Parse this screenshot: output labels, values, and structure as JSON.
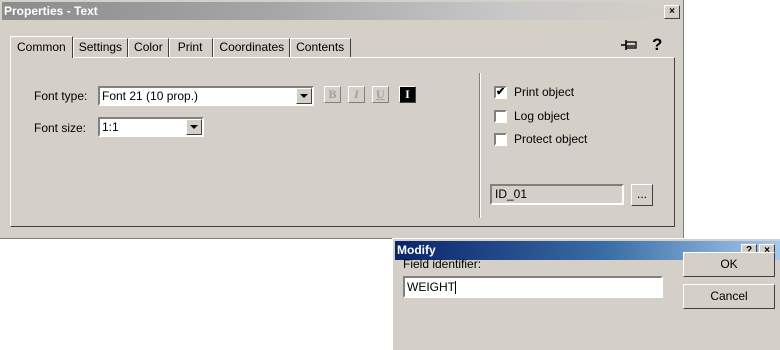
{
  "properties_window": {
    "title": "Properties - Text",
    "close_glyph": "×",
    "tabs": [
      "Common",
      "Settings",
      "Color",
      "Print",
      "Coordinates",
      "Contents"
    ],
    "active_tab": "Common",
    "pin_icon": "pin-icon",
    "help_glyph": "?",
    "font_type_label": "Font type:",
    "font_type_value": "Font 21 (10 prop.)",
    "font_size_label": "Font size:",
    "font_size_value": "1:1",
    "format_buttons": [
      "B",
      "I",
      "U",
      "I"
    ],
    "checkboxes": [
      {
        "label": "Print object",
        "checked": true
      },
      {
        "label": "Log object",
        "checked": false
      },
      {
        "label": "Protect object",
        "checked": false
      }
    ],
    "check_glyph": "✔",
    "id_value": "ID_01",
    "browse_label": "..."
  },
  "modify_dialog": {
    "title": "Modify",
    "help_glyph": "?",
    "close_glyph": "×",
    "field_label": "Field identifier:",
    "field_value": "WEIGHT",
    "ok_label": "OK",
    "cancel_label": "Cancel"
  },
  "colors": {
    "face": "#d4d0c8",
    "inactive_title": "#a6a6a6",
    "active_title": "#0a246a"
  }
}
